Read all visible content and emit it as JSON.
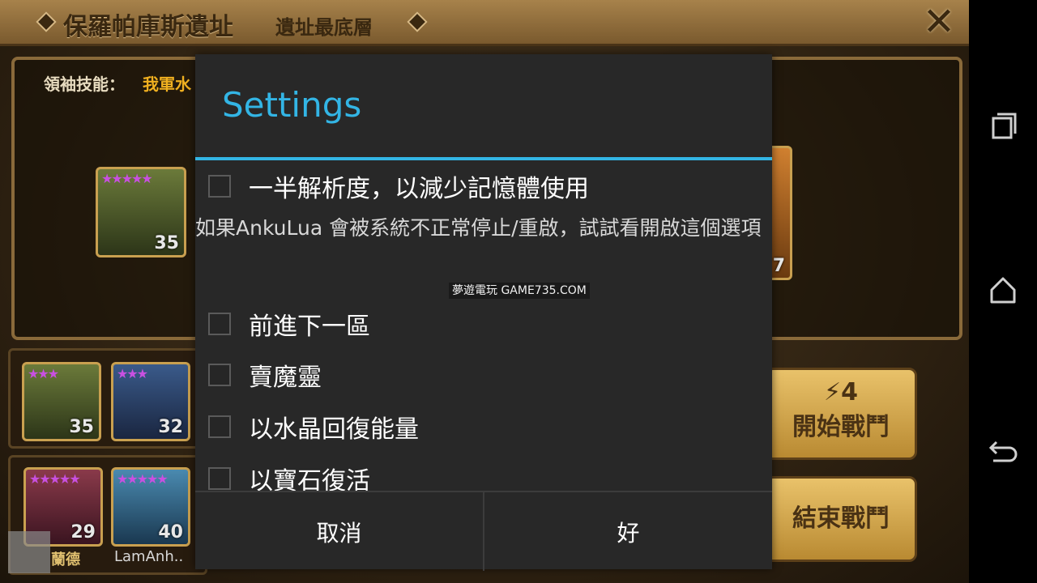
{
  "game": {
    "title": "保羅帕庫斯遺址",
    "subtitle": "遺址最底層",
    "leader_label": "領袖技能：",
    "leader_value": "我軍水",
    "portrait_main_level": "35",
    "portrait_right_level": "7",
    "team": [
      {
        "level": "35"
      },
      {
        "level": "32"
      }
    ],
    "bench": [
      {
        "level": "29",
        "name": "蘭德"
      },
      {
        "level": "40",
        "name": "LamAnh.."
      }
    ],
    "start_battle": {
      "energy": "4",
      "label": "開始戰鬥"
    },
    "end_battle": {
      "label": "結束戰鬥"
    }
  },
  "dialog": {
    "title": "Settings",
    "options": [
      {
        "label": "一半解析度，以減少記憶體使用",
        "checked": false
      },
      {
        "label": "前進下一區",
        "checked": false
      },
      {
        "label": "賣魔靈",
        "checked": false
      },
      {
        "label": "以水晶回復能量",
        "checked": false
      },
      {
        "label": "以寶石復活",
        "checked": false
      }
    ],
    "description": "如果AnkuLua 會被系統不正常停止/重啟，試試看開啟這個選項",
    "watermark": "夢遊電玩 GAME735.COM",
    "cancel_label": "取消",
    "ok_label": "好"
  },
  "colors": {
    "accent": "#33b5e5",
    "dialog_bg": "#282828"
  },
  "navbar": {
    "icons": [
      "recent-apps-icon",
      "home-icon",
      "back-icon"
    ]
  }
}
